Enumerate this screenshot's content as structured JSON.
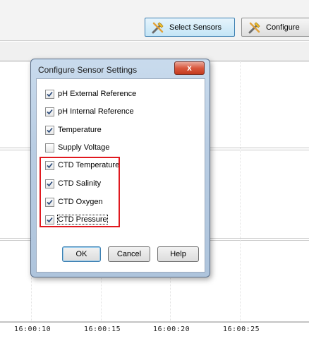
{
  "toolbar": {
    "select_sensors_label": "Select Sensors",
    "configure_label": "Configure",
    "select_sensors_icon": "tools-icon",
    "configure_icon": "tools-icon"
  },
  "dialog": {
    "title": "Configure Sensor Settings",
    "close_label": "x",
    "sensors": [
      {
        "label": "pH External Reference",
        "checked": true
      },
      {
        "label": "pH Internal Reference",
        "checked": true
      },
      {
        "label": "Temperature",
        "checked": true
      },
      {
        "label": "Supply Voltage",
        "checked": false
      },
      {
        "label": "CTD Temperature",
        "checked": true
      },
      {
        "label": "CTD Salinity",
        "checked": true
      },
      {
        "label": "CTD Oxygen",
        "checked": true
      },
      {
        "label": "CTD Pressure",
        "checked": true
      }
    ],
    "buttons": {
      "ok": "OK",
      "cancel": "Cancel",
      "help": "Help"
    }
  },
  "chart": {
    "x_ticks": [
      "16:00:10",
      "16:00:15",
      "16:00:20",
      "16:00:25"
    ]
  },
  "colors": {
    "highlight": "#e0191f",
    "accent": "#3c7fb1"
  }
}
